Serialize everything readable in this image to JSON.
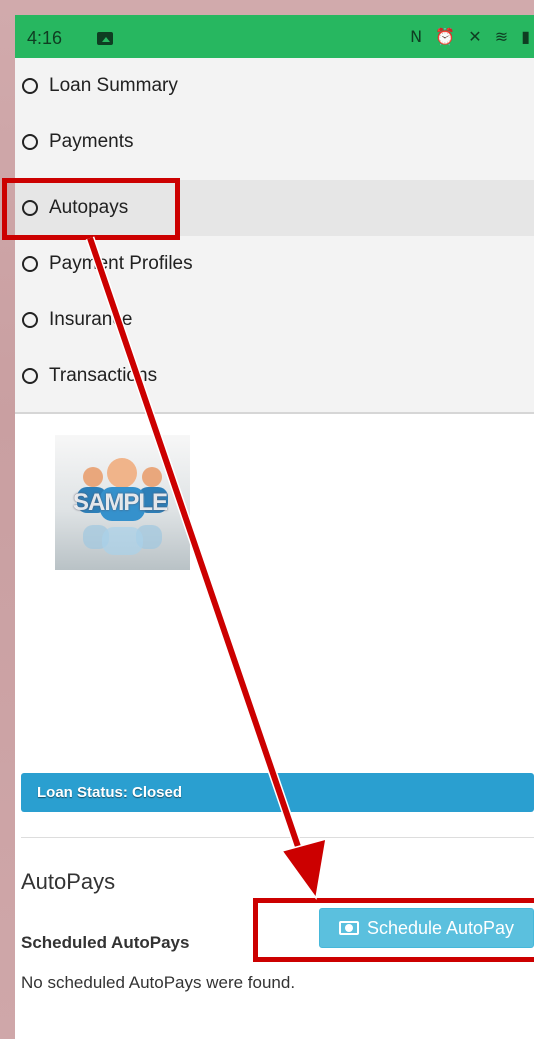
{
  "status_bar": {
    "time": "4:16",
    "icons": "N ⏰ ✕ ≋ ▮",
    "color": "#27b760"
  },
  "menu": {
    "items": [
      {
        "label": "Loan Summary",
        "active": false
      },
      {
        "label": "Payments",
        "active": false
      },
      {
        "label": "Autopays",
        "active": true
      },
      {
        "label": "Payment Profiles",
        "active": false
      },
      {
        "label": "Insurance",
        "active": false
      },
      {
        "label": "Transactions",
        "active": false
      }
    ]
  },
  "avatar": {
    "watermark": "SAMPLE"
  },
  "loan_status": {
    "label": "Loan Status: Closed",
    "color": "#2a9fd0"
  },
  "autopays": {
    "title": "AutoPays",
    "schedule_button_label": "Schedule AutoPay",
    "scheduled_heading": "Scheduled AutoPays",
    "empty_message": "No scheduled AutoPays were found."
  },
  "annotation": {
    "color": "#cc0000"
  }
}
